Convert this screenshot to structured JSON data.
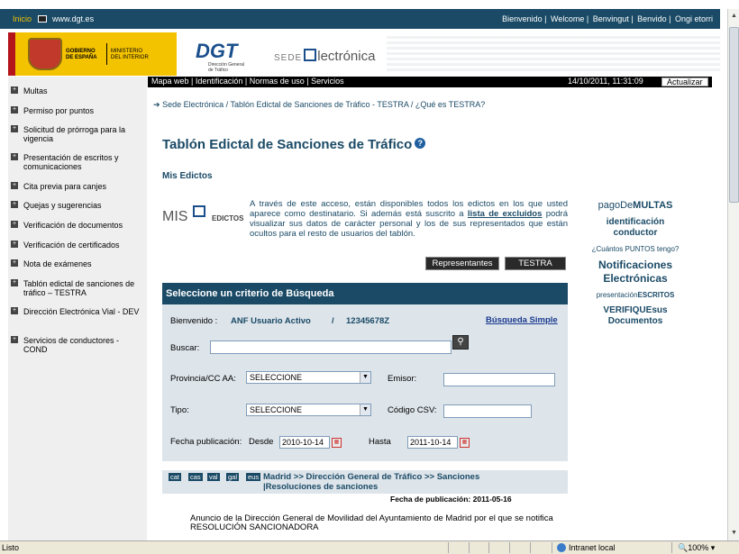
{
  "topbar": {
    "inicio": "Inicio",
    "site": "www.dgt.es",
    "languages": [
      "Bienvenido",
      "Welcome",
      "Benvingut",
      "Benvido",
      "Ongi etorri"
    ]
  },
  "banner": {
    "gov_line1": "GOBIERNO",
    "gov_line2": "DE ESPAÑA",
    "min_line1": "MINISTERIO",
    "min_line2": "DEL INTERIOR",
    "dgt_logo": "DGT",
    "dgt_sub1": "Dirección General",
    "dgt_sub2": "de Tráfico",
    "sede_pre": "SEDE",
    "sede_post": "lectrónica"
  },
  "navbar": {
    "links": "Mapa web | Identificación | Normas de uso | Servicios",
    "datetime": "14/10/2011, 11:31:09",
    "update_label": "Actualizar"
  },
  "sidebar": {
    "items": [
      {
        "label": "Multas"
      },
      {
        "label": "Permiso por puntos"
      },
      {
        "label": "Solicitud de prórroga para la vigencia"
      },
      {
        "label": "Presentación de escritos y comunicaciones"
      },
      {
        "label": "Cita previa para canjes"
      },
      {
        "label": "Quejas y sugerencias"
      },
      {
        "label": "Verificación de documentos"
      },
      {
        "label": "Verificación de certificados"
      },
      {
        "label": "Nota de exámenes"
      },
      {
        "label": "Tablón edictal de sanciones de tráfico – TESTRA"
      },
      {
        "label": "Dirección Electrónica Vial - DEV"
      },
      {
        "label": "Servicios de conductores - COND"
      }
    ]
  },
  "breadcrumb": {
    "c1": "Sede Electrónica",
    "c2": "Tablón Edictal de Sanciones de Tráfico - TESTRA",
    "c3": "¿Qué es TESTRA?"
  },
  "page": {
    "title": "Tablón Edictal de Sanciones de Tráfico",
    "help": "?",
    "subtitle": "Mis Edictos",
    "mis_logo_a": "MIS",
    "mis_logo_b": "EDICTOS",
    "intro_a": "A través de este acceso, están disponibles todos los edictos en los que usted aparece como destinatario. Si además está suscrito a ",
    "intro_link": "lista de excluidos",
    "intro_b": " podrá visualizar sus datos de carácter personal y los de sus representados que están ocultos para el resto de usuarios del tablón.",
    "btn_representantes": "Representantes",
    "btn_testra": "TESTRA"
  },
  "search": {
    "header": "Seleccione un criterio de Búsqueda",
    "welcome": "Bienvenido :",
    "user": "ANF Usuario Activo",
    "slash": "/",
    "user_id": "12345678Z",
    "simple": "Búsqueda Simple",
    "buscar": "Buscar:",
    "buscar_value": "",
    "provincia": "Provincia/CC AA:",
    "provincia_value": "SELECCIONE",
    "emisor": "Emisor:",
    "emisor_value": "",
    "tipo": "Tipo:",
    "tipo_value": "SELECCIONE",
    "csv": "Código CSV:",
    "csv_value": "",
    "fecha": "Fecha publicación:",
    "desde": "Desde",
    "desde_value": "2010-10-14",
    "hasta": "Hasta",
    "hasta_value": "2011-10-14"
  },
  "result": {
    "langs": [
      "cat",
      "cas",
      "val",
      "gal",
      "eus"
    ],
    "path": "Madrid >> Dirección General de Tráfico >> Sanciones |Resoluciones de sanciones",
    "fecha": "Fecha de publicación: 2011-05-16",
    "anuncio": "Anuncio de la Dirección General de Movilidad del Ayuntamiento de Madrid por el que se notifica RESOLUCIÓN SANCIONADORA"
  },
  "rightside": {
    "pago_a": "pagoDe",
    "pago_b": "MULTAS",
    "ident": "identificación conductor",
    "puntos": "¿Cuántos PUNTOS tengo?",
    "notif": "Notificaciones Electrónicas",
    "pres_a": "presentación",
    "pres_b": "ESCRITOS",
    "verif_a": "VERIFIQUE",
    "verif_b": "sus Documentos"
  },
  "status": {
    "text": "Listo",
    "zone": "Intranet local",
    "zoom": "100%"
  }
}
